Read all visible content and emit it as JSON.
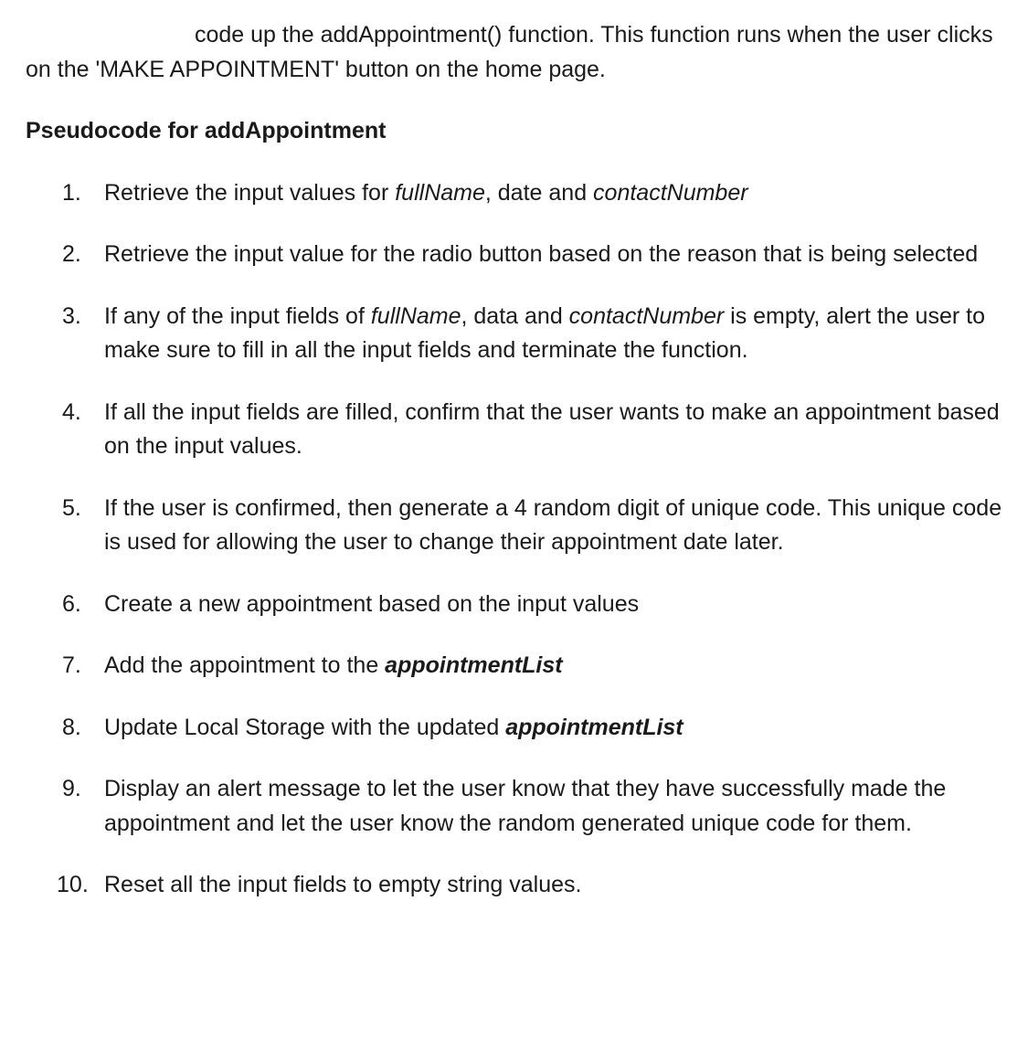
{
  "intro": {
    "part1": "code up the addAppointment() function. This function runs when the user clicks on the 'MAKE APPOINTMENT' button on the home page."
  },
  "sectionTitle": "Pseudocode for addAppointment",
  "steps": [
    {
      "segments": [
        {
          "text": "Retrieve the input values for "
        },
        {
          "text": "fullName",
          "style": "italic"
        },
        {
          "text": ", date and "
        },
        {
          "text": "contactNumber",
          "style": "italic"
        }
      ]
    },
    {
      "segments": [
        {
          "text": "Retrieve the input value for the radio button based on the reason that is being selected"
        }
      ]
    },
    {
      "segments": [
        {
          "text": "If any of the input fields of "
        },
        {
          "text": "fullName",
          "style": "italic"
        },
        {
          "text": ", data and "
        },
        {
          "text": "contactNumber",
          "style": "italic"
        },
        {
          "text": " is empty, alert the user to make sure to fill in all the input fields and terminate the function."
        }
      ]
    },
    {
      "segments": [
        {
          "text": "If all the input fields are filled, confirm that the user wants to make an appointment based on the input values."
        }
      ]
    },
    {
      "segments": [
        {
          "text": "If the user is confirmed, then generate a 4 random digit of unique code. This unique code is used for allowing the user to change their appointment date later."
        }
      ]
    },
    {
      "segments": [
        {
          "text": "Create a new appointment based on the input values"
        }
      ]
    },
    {
      "segments": [
        {
          "text": "Add the appointment to the "
        },
        {
          "text": "appointmentList",
          "style": "bolditalic"
        }
      ]
    },
    {
      "segments": [
        {
          "text": "Update Local Storage with the updated "
        },
        {
          "text": "appointmentList",
          "style": "bolditalic"
        }
      ]
    },
    {
      "segments": [
        {
          "text": "Display an alert message to let the user know that they have successfully made the appointment and let the user know the random generated unique code for them."
        }
      ]
    },
    {
      "segments": [
        {
          "text": "Reset all the input fields to empty string values."
        }
      ]
    }
  ]
}
